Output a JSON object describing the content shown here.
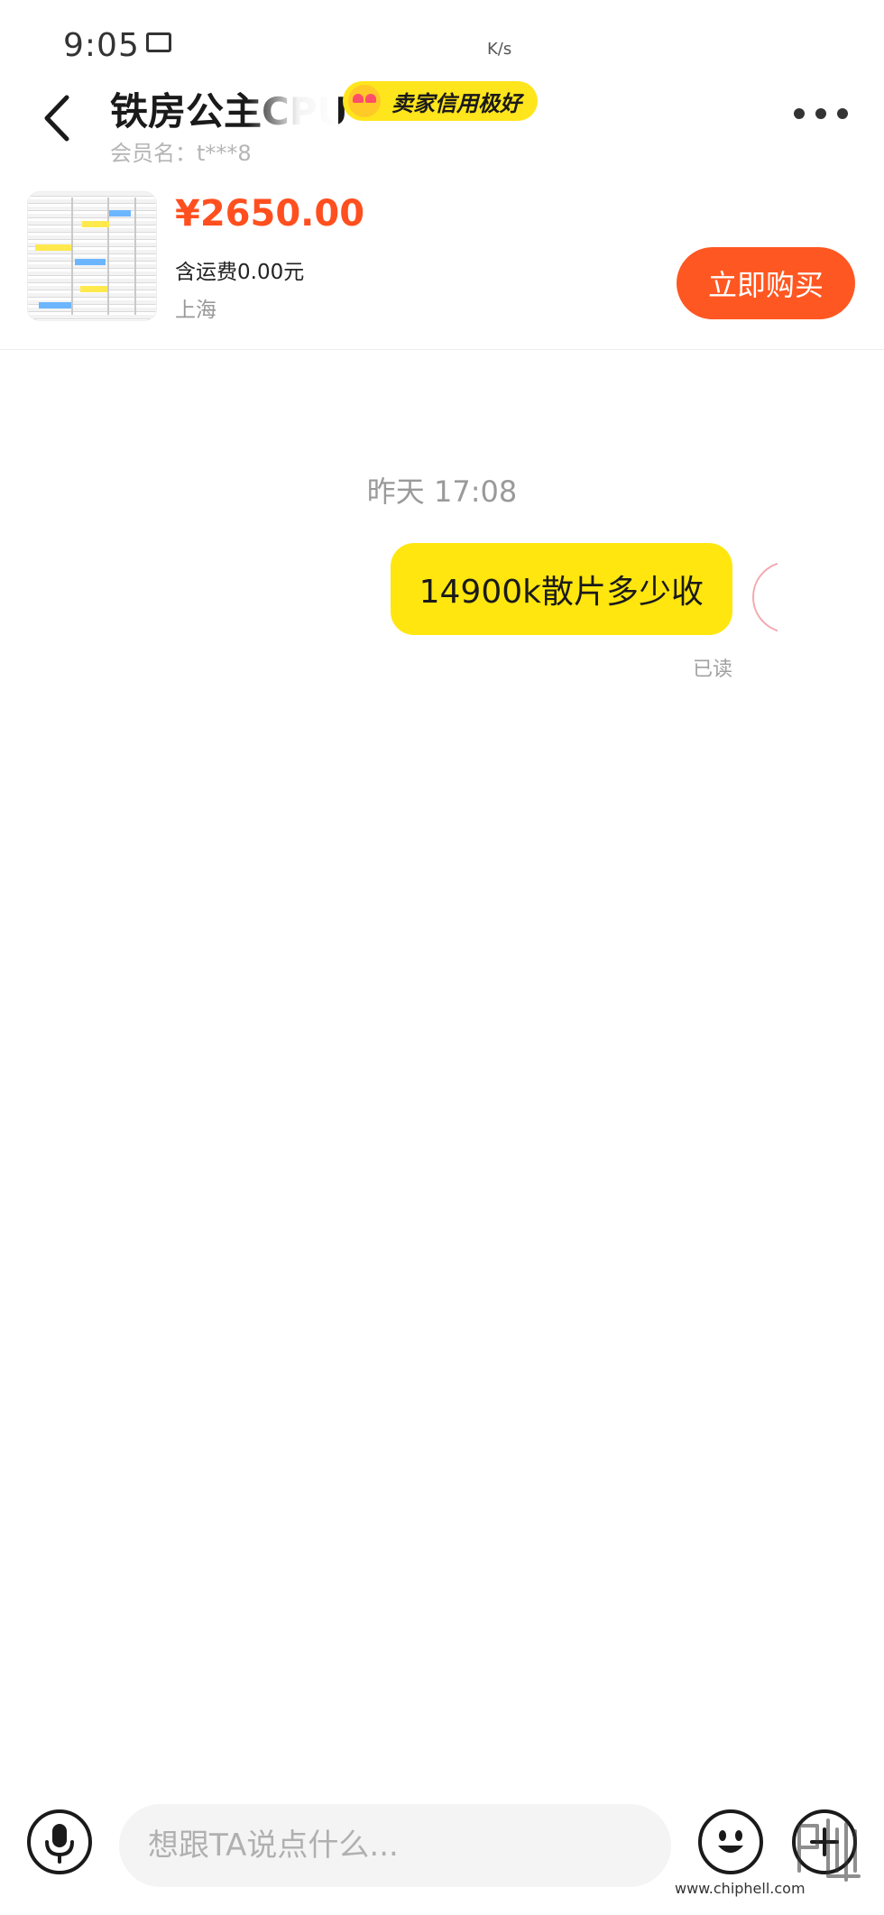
{
  "status_bar": {
    "time": "9:05",
    "network": "K/s"
  },
  "header": {
    "seller_name": "铁房公主CPU",
    "credit_badge": "卖家信用极好",
    "member_label": "会员名：",
    "member_id": "t***8"
  },
  "product": {
    "price": "¥2650.00",
    "shipping": "含运费0.00元",
    "location": "上海",
    "buy_label": "立即购买"
  },
  "chat": {
    "timestamp": "昨天 17:08",
    "messages": [
      {
        "text": "14900k散片多少收",
        "status": "已读"
      }
    ]
  },
  "composer": {
    "placeholder": "想跟TA说点什么..."
  },
  "watermark": {
    "text": "www.chiphell.com"
  },
  "colors": {
    "accent_orange": "#ff5722",
    "price_red": "#ff4f1f",
    "bubble_yellow": "#ffe60f",
    "badge_yellow": "#ffe51c"
  },
  "icons": {
    "back": "chevron-left-icon",
    "more": "more-horizontal-icon",
    "mic": "microphone-icon",
    "emoji": "smiley-icon",
    "plus": "plus-icon"
  }
}
